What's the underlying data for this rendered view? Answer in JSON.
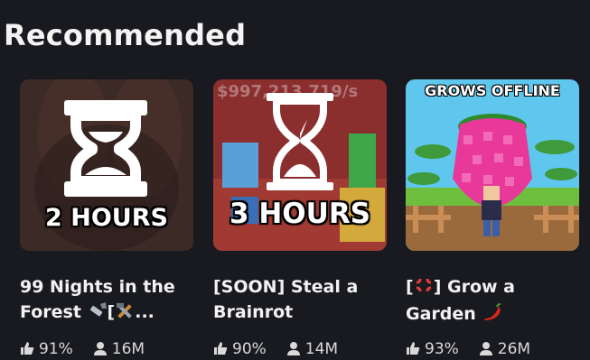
{
  "section": {
    "title": "Recommended"
  },
  "cards": [
    {
      "overlay": "2 HOURS",
      "title_line1": "99 Nights in the",
      "title_line2_text": "Forest",
      "title_line2_bracket": "[",
      "title_line2_ellipsis": "...",
      "rating": "91%",
      "players": "16M",
      "icons": [
        "flashlight-icon",
        "hammer-and-wrench-icon"
      ]
    },
    {
      "overlay": "3 HOURS",
      "money": "$997,213,719/s",
      "title_line1": "[SOON] Steal a",
      "title_line2": "Brainrot",
      "rating": "90%",
      "players": "14M"
    },
    {
      "overlay": "GROWS OFFLINE",
      "title_line1_open": "[",
      "title_line1_rest": "] Grow a",
      "title_line2": "Garden",
      "rating": "93%",
      "players": "26M",
      "icons": [
        "anger-symbol-icon",
        "chili-pepper-icon"
      ]
    }
  ],
  "colors": {
    "background": "#191a1f",
    "text": "#f2f2f2",
    "card1_bg": "#3a2a26",
    "card2_bg": "#8b2f2f",
    "card3_sky": "#5fc7ee"
  }
}
